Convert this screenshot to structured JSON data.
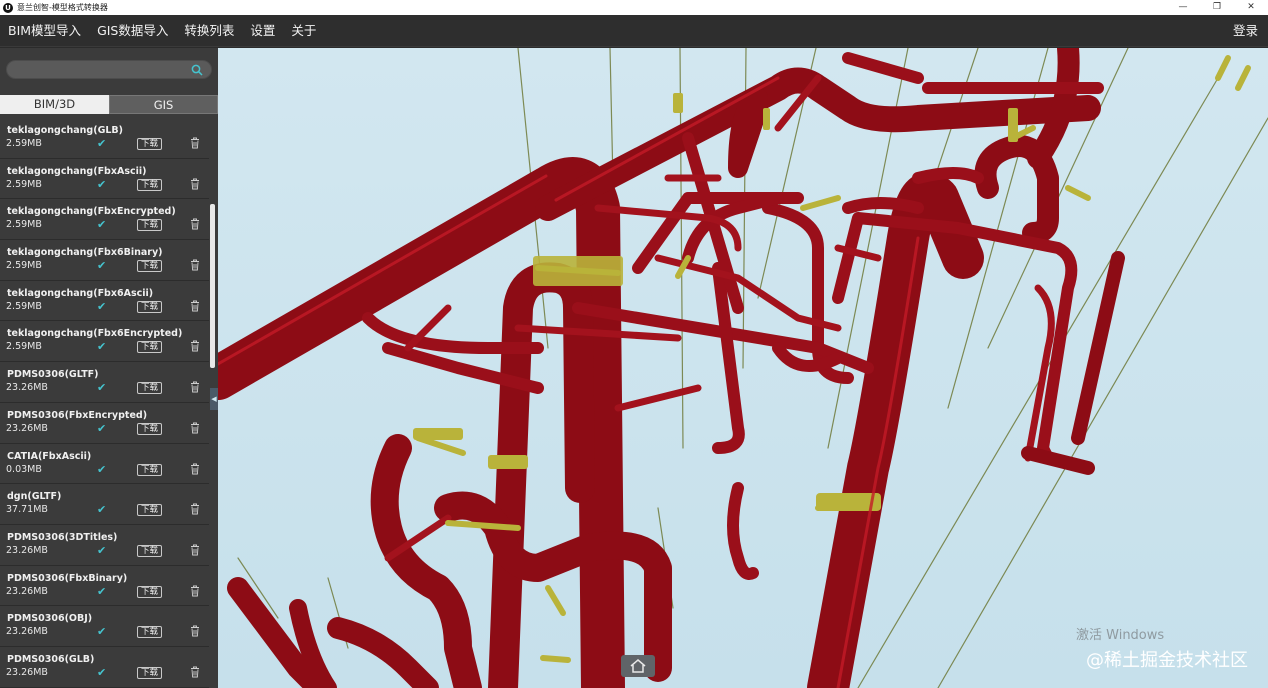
{
  "window": {
    "title": "意兰创智-模型格式转换器",
    "icon_letter": "U",
    "controls": [
      "—",
      "❐",
      "✕"
    ]
  },
  "menu": {
    "items": [
      "BIM模型导入",
      "GIS数据导入",
      "转换列表",
      "设置",
      "关于"
    ],
    "login": "登录"
  },
  "sidebar": {
    "search": {
      "placeholder": "",
      "value": ""
    },
    "tabs": [
      {
        "label": "BIM/3D",
        "active": true
      },
      {
        "label": "GIS",
        "active": false
      }
    ],
    "download_label": "下载",
    "items": [
      {
        "name": "teklagongchang(GLB)",
        "size": "2.59MB"
      },
      {
        "name": "teklagongchang(FbxAscii)",
        "size": "2.59MB"
      },
      {
        "name": "teklagongchang(FbxEncrypted)",
        "size": "2.59MB"
      },
      {
        "name": "teklagongchang(Fbx6Binary)",
        "size": "2.59MB"
      },
      {
        "name": "teklagongchang(Fbx6Ascii)",
        "size": "2.59MB"
      },
      {
        "name": "teklagongchang(Fbx6Encrypted)",
        "size": "2.59MB"
      },
      {
        "name": "PDMS0306(GLTF)",
        "size": "23.26MB"
      },
      {
        "name": "PDMS0306(FbxEncrypted)",
        "size": "23.26MB"
      },
      {
        "name": "CATIA(FbxAscii)",
        "size": "0.03MB"
      },
      {
        "name": "dgn(GLTF)",
        "size": "37.71MB"
      },
      {
        "name": "PDMS0306(3DTitles)",
        "size": "23.26MB"
      },
      {
        "name": "PDMS0306(FbxBinary)",
        "size": "23.26MB"
      },
      {
        "name": "PDMS0306(OBJ)",
        "size": "23.26MB"
      },
      {
        "name": "PDMS0306(GLB)",
        "size": "23.26MB"
      }
    ]
  },
  "viewport": {
    "watermark_line1": "激活 Windows",
    "watermark_line2": "@稀土掘金技术社区"
  },
  "colors": {
    "pipe": "#8d0c15",
    "pipe_highlight": "#c31a27",
    "support": "#b9b33a",
    "sky": "#cde4ee",
    "check": "#45c4cf"
  }
}
